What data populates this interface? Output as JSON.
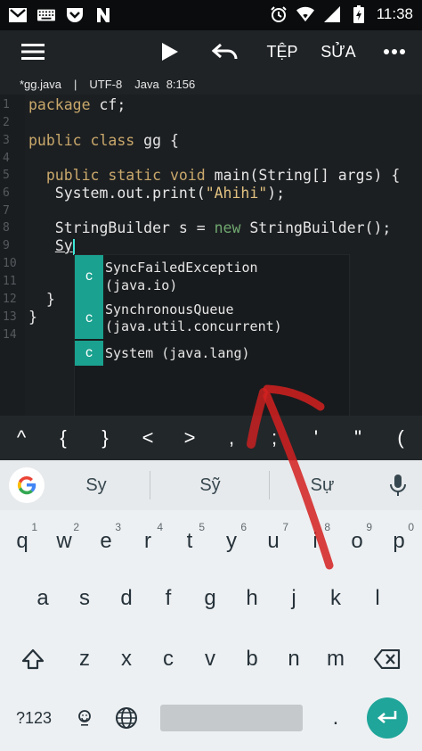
{
  "status_bar": {
    "time": "11:38",
    "left_icons": [
      "gmail-icon",
      "keyboard-icon",
      "pocket-icon",
      "n-icon"
    ],
    "right_icons": [
      "alarm-icon",
      "wifi-icon",
      "signal-icon",
      "battery-icon"
    ]
  },
  "toolbar": {
    "menu_icon": "hamburger-menu-icon",
    "run_icon": "play-icon",
    "undo_icon": "undo-icon",
    "file_label": "TỆP",
    "edit_label": "SỬA",
    "more_icon": "more-dots-icon"
  },
  "file_info": {
    "filename": "*gg.java",
    "separator": "|",
    "encoding": "UTF-8",
    "language": "Java",
    "position": "8:156"
  },
  "editor": {
    "line_numbers": [
      "1",
      "2",
      "3",
      "4",
      "5",
      "6",
      "7",
      "8",
      "9",
      "10",
      "11",
      "12",
      "13",
      "14"
    ],
    "typed_text": "Sy"
  },
  "autocomplete": {
    "items": [
      {
        "kind": "c",
        "name": "SyncFailedException",
        "package": "(java.io)"
      },
      {
        "kind": "c",
        "name": "SynchronousQueue",
        "package": "(java.util.concurrent)"
      },
      {
        "kind": "c",
        "name": "System (java.lang)",
        "package": ""
      }
    ]
  },
  "symbol_bar": {
    "keys": [
      "^",
      "{",
      "}",
      "<",
      ">",
      ",",
      ";",
      "'",
      "\"",
      "("
    ]
  },
  "suggestions": {
    "google_icon": "google-g-icon",
    "words": [
      "Sy",
      "Sỹ",
      "Sự"
    ],
    "mic_icon": "microphone-icon"
  },
  "keyboard": {
    "row1": [
      {
        "key": "q",
        "hint": "1"
      },
      {
        "key": "w",
        "hint": "2"
      },
      {
        "key": "e",
        "hint": "3"
      },
      {
        "key": "r",
        "hint": "4"
      },
      {
        "key": "t",
        "hint": "5"
      },
      {
        "key": "y",
        "hint": "6"
      },
      {
        "key": "u",
        "hint": "7"
      },
      {
        "key": "i",
        "hint": "8"
      },
      {
        "key": "o",
        "hint": "9"
      },
      {
        "key": "p",
        "hint": "0"
      }
    ],
    "row2": [
      "a",
      "s",
      "d",
      "f",
      "g",
      "h",
      "j",
      "k",
      "l"
    ],
    "row3": [
      "z",
      "x",
      "c",
      "v",
      "b",
      "n",
      "m"
    ],
    "shift_icon": "shift-icon",
    "backspace_icon": "backspace-icon",
    "symbols_label": "?123",
    "emoji_icon": "emoji-icon",
    "globe_icon": "globe-icon",
    "period": ".",
    "enter_icon": "enter-icon"
  },
  "colors": {
    "accent": "#1aa18f",
    "annotation": "#d32020",
    "enter_button": "#1fa59a"
  }
}
